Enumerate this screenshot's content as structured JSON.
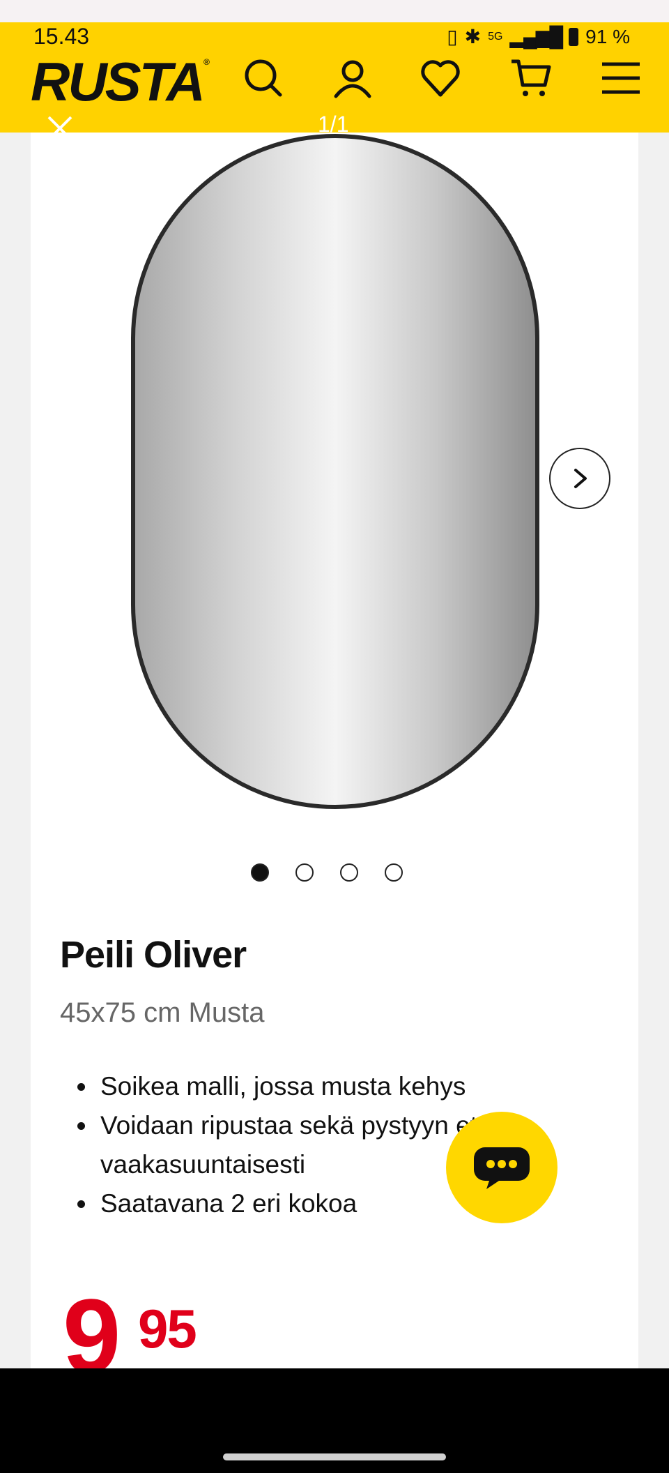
{
  "status_bar": {
    "time": "15.43",
    "network": "5G",
    "battery": "91 %"
  },
  "header": {
    "logo": "RUSTA",
    "icons": [
      "search-icon",
      "account-icon",
      "heart-icon",
      "cart-icon",
      "menu-icon"
    ],
    "brand_color": "#ffd200"
  },
  "gallery": {
    "counter": "1/1",
    "dots": [
      true,
      false,
      false,
      false
    ]
  },
  "product": {
    "title": "Peili Oliver",
    "subtitle": "45x75 cm Musta",
    "features": [
      "Soikea malli, jossa musta kehys",
      "Voidaan ripustaa sekä pystyyn että vaakasuuntaisesti",
      "Saatavana 2 eri kokoa"
    ],
    "price_euros": "9",
    "price_cents": "95",
    "price_color": "#e0001a"
  },
  "chat": {
    "icon": "chat-bubble-icon",
    "color": "#ffd700"
  }
}
